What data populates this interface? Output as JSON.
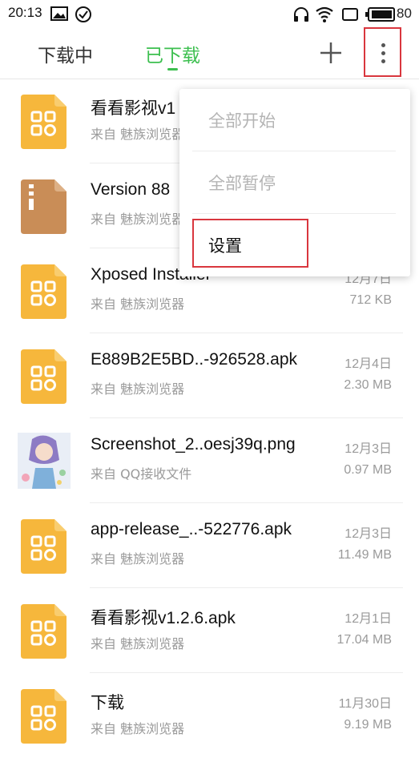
{
  "status_bar": {
    "time": "20:13",
    "battery_level": "80",
    "left_icons": [
      "image-notification-icon",
      "check-circle-icon"
    ],
    "right_icons": [
      "headphones-icon",
      "wifi-icon",
      "screen-icon",
      "battery-icon"
    ]
  },
  "tabs": [
    {
      "label": "下载中",
      "active": false
    },
    {
      "label": "已下载",
      "active": true
    }
  ],
  "accent_color": "#3cbf4f",
  "menu": {
    "items": [
      {
        "label": "全部开始",
        "enabled": false
      },
      {
        "label": "全部暂停",
        "enabled": false
      },
      {
        "label": "设置",
        "enabled": true
      }
    ]
  },
  "files": [
    {
      "name": "看看影视v1",
      "source": "来自 魅族浏览器",
      "date": "",
      "size": "",
      "icon": "apk-file-icon"
    },
    {
      "name": "Version 88",
      "source": "来自 魅族浏览器",
      "date": "",
      "size": "",
      "icon": "archive-file-icon"
    },
    {
      "name": "Xposed Installer",
      "source": "来自 魅族浏览器",
      "date": "12月7日",
      "size": "712 KB",
      "icon": "apk-file-icon"
    },
    {
      "name": "E889B2E5BD..-926528.apk",
      "source": "来自 魅族浏览器",
      "date": "12月4日",
      "size": "2.30 MB",
      "icon": "apk-file-icon"
    },
    {
      "name": "Screenshot_2..oesj39q.png",
      "source": "来自 QQ接收文件",
      "date": "12月3日",
      "size": "0.97 MB",
      "icon": "image-thumbnail"
    },
    {
      "name": "app-release_..-522776.apk",
      "source": "来自 魅族浏览器",
      "date": "12月3日",
      "size": "11.49 MB",
      "icon": "apk-file-icon"
    },
    {
      "name": "看看影视v1.2.6.apk",
      "source": "来自 魅族浏览器",
      "date": "12月1日",
      "size": "17.04 MB",
      "icon": "apk-file-icon"
    },
    {
      "name": "下载",
      "source": "来自 魅族浏览器",
      "date": "11月30日",
      "size": "9.19 MB",
      "icon": "apk-file-icon"
    }
  ]
}
